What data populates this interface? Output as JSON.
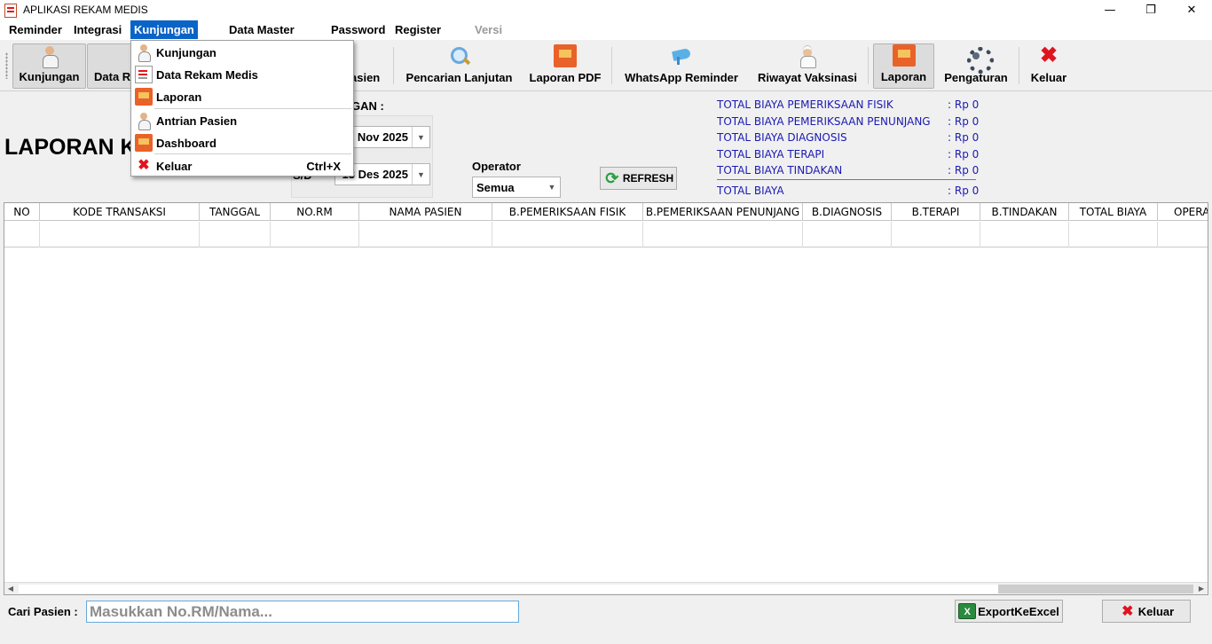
{
  "window": {
    "title": "APLIKASI REKAM MEDIS",
    "minimize": "—",
    "maximize": "❐",
    "close": "✕"
  },
  "menu": {
    "reminder": "Reminder",
    "integrasi": "Integrasi",
    "kunjungan": "Kunjungan",
    "data_master": "Data Master",
    "password": "Password",
    "register": "Register",
    "versi": "Versi"
  },
  "toolbar": {
    "kunjungan": "Kunjungan",
    "data_rm": "Data R",
    "antrian_pasien": "asien",
    "pencarian_lanjutan": "Pencarian Lanjutan",
    "laporan_pdf": "Laporan PDF",
    "whatsapp_reminder": "WhatsApp Reminder",
    "riwayat_vaksinasi": "Riwayat Vaksinasi",
    "laporan": "Laporan",
    "pengaturan": "Pengaturan",
    "keluar": "Keluar"
  },
  "dropdown": {
    "kunjungan": "Kunjungan",
    "data_rekam_medis": "Data Rekam Medis",
    "laporan": "Laporan",
    "antrian_pasien": "Antrian Pasien",
    "dashboard": "Dashboard",
    "keluar": "Keluar",
    "keluar_shortcut": "Ctrl+X"
  },
  "report": {
    "title": "LAPORAN KU",
    "range_label": "GAN :",
    "sd_label": "S/D",
    "date_from": "Nov 2025",
    "date_to": "13 Des 2025",
    "operator_label": "Operator",
    "operator_value": "Semua",
    "refresh_label": "REFRESH"
  },
  "totals": [
    {
      "label": "TOTAL BIAYA PEMERIKSAAN FISIK",
      "value": ": Rp 0"
    },
    {
      "label": "TOTAL BIAYA PEMERIKSAAN PENUNJANG",
      "value": ": Rp 0"
    },
    {
      "label": "TOTAL BIAYA DIAGNOSIS",
      "value": ": Rp 0"
    },
    {
      "label": "TOTAL BIAYA TERAPI",
      "value": ": Rp 0"
    },
    {
      "label": "TOTAL BIAYA TINDAKAN",
      "value": ": Rp 0"
    },
    {
      "label": "TOTAL BIAYA",
      "value": ": Rp 0"
    }
  ],
  "table": {
    "columns": [
      "NO",
      "KODE TRANSAKSI",
      "TANGGAL",
      "NO.RM",
      "NAMA PASIEN",
      "B.PEMERIKSAAN FISIK",
      "B.PEMERIKSAAN PENUNJANG",
      "B.DIAGNOSIS",
      "B.TERAPI",
      "B.TINDAKAN",
      "TOTAL BIAYA",
      "OPERA"
    ]
  },
  "footer": {
    "search_label": "Cari Pasien :",
    "search_placeholder": "Masukkan No.RM/Nama...",
    "export_label": "ExportKeExcel",
    "keluar_label": "Keluar"
  },
  "colors": {
    "accent": "#0a64c8",
    "totals_text": "#1a1ab4",
    "close_red": "#e0141e"
  }
}
